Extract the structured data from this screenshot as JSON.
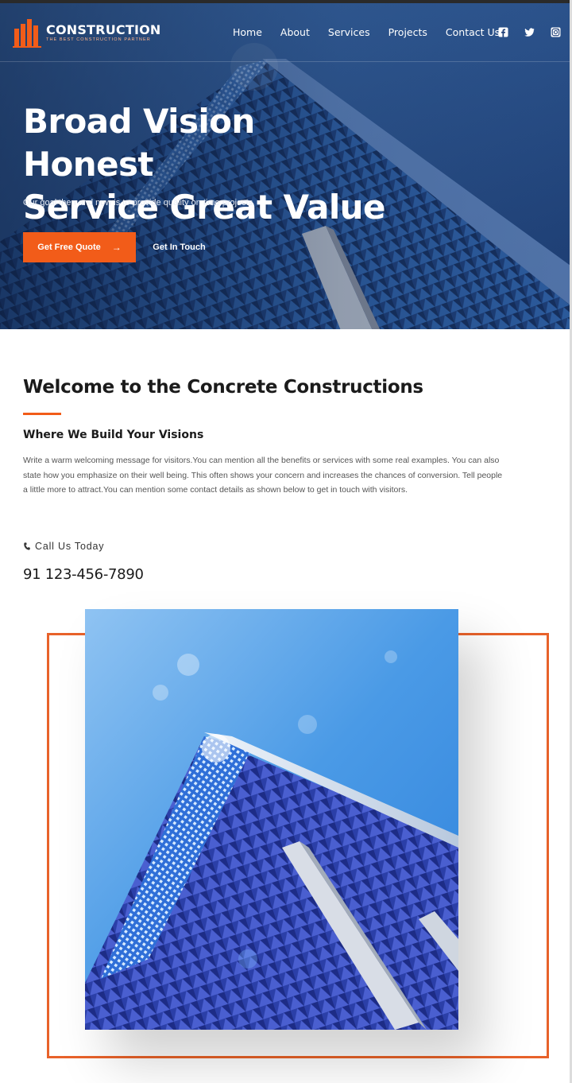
{
  "brand": {
    "name": "CONSTRUCTION",
    "tagline": "THE BEST CONSTRUCTION PARTNER",
    "accent_color": "#f25c19"
  },
  "nav": {
    "links": [
      "Home",
      "About",
      "Services",
      "Projects",
      "Contact Us"
    ],
    "social_icons": [
      "facebook-icon",
      "twitter-icon",
      "instagram-icon"
    ]
  },
  "hero": {
    "title_line1": "Broad Vision Honest",
    "title_line2": "Service Great Value",
    "subtitle": "Our goal then and now is to provide quality on time projects",
    "primary_button": "Get Free Quote",
    "primary_button_icon": "arrow-right-icon",
    "secondary_button": "Get In Touch"
  },
  "welcome": {
    "title": "Welcome to the Concrete Constructions",
    "subtitle": "Where We Build Your Visions",
    "body": "Write a warm welcoming message for visitors.You can mention all the benefits or services with some real examples. You can also state how you emphasize on their well being. This often shows your concern and increases the chances of conversion. Tell people a little more to attract.You can mention some contact details as shown below to get in touch with visitors.",
    "call_label": "Call Us Today",
    "call_icon": "phone-icon",
    "phone": "91 123-456-7890"
  },
  "feature": {
    "frame_color": "#e8622a"
  }
}
